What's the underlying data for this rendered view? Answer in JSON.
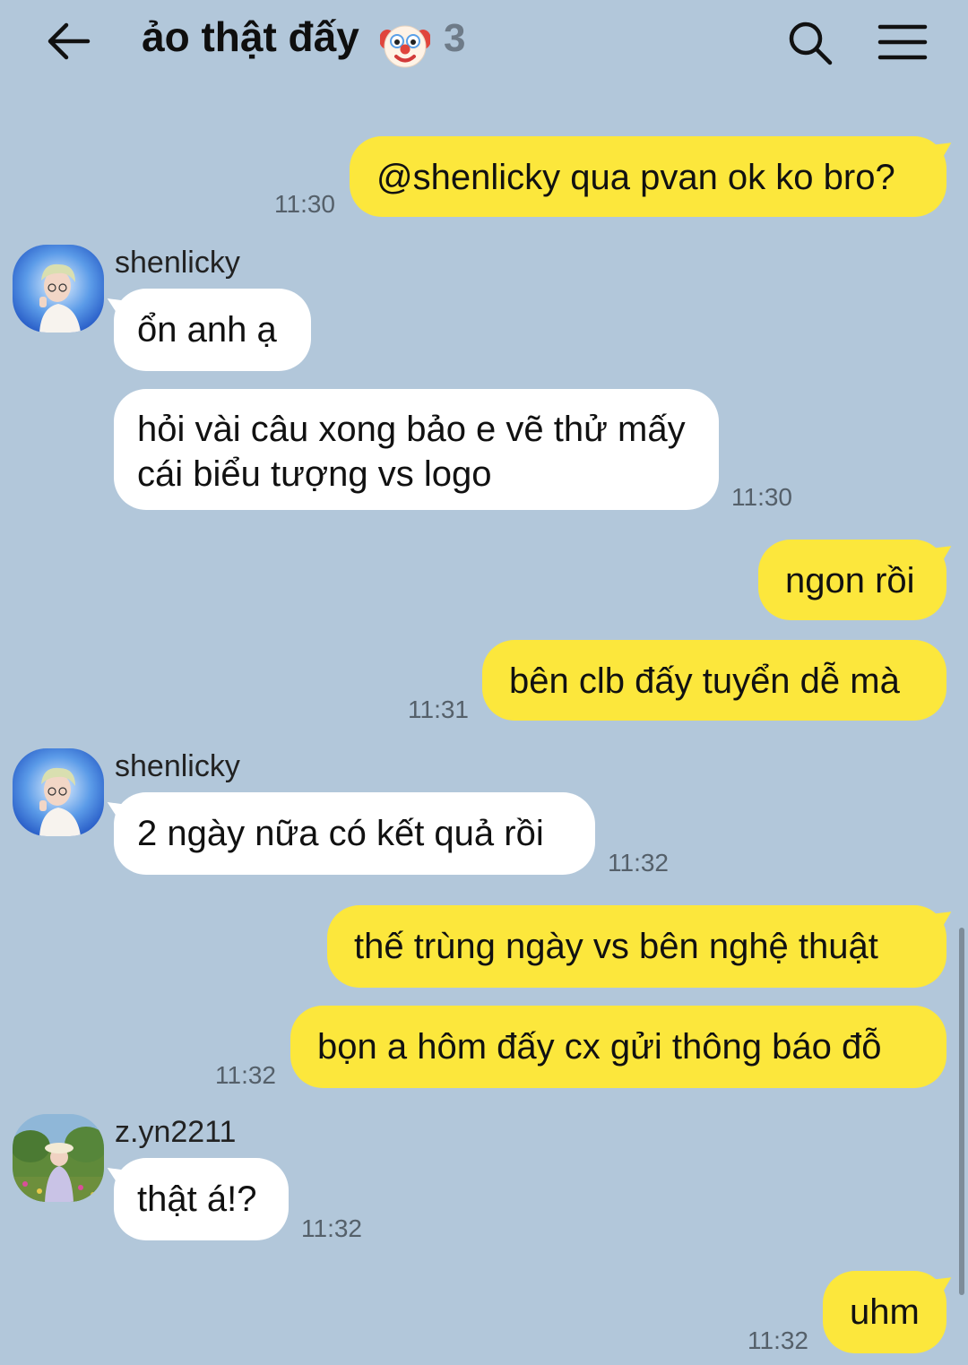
{
  "header": {
    "title": "ảo thật đấy",
    "member_count": "3"
  },
  "messages": [
    {
      "text": "@shenlicky qua pvan ok ko bro?",
      "time": "11:30"
    },
    {
      "sender": "shenlicky",
      "text": "ổn anh ạ"
    },
    {
      "text": "hỏi vài câu xong bảo e vẽ thử mấy cái biểu tượng vs logo",
      "time": "11:30"
    },
    {
      "text": "ngon rồi"
    },
    {
      "text": "bên clb đấy tuyển dễ mà",
      "time": "11:31"
    },
    {
      "sender": "shenlicky",
      "text": "2 ngày nữa có kết quả rồi",
      "time": "11:32"
    },
    {
      "text": "thế trùng ngày vs bên nghệ thuật"
    },
    {
      "text": "bọn a hôm đấy cx gửi thông báo đỗ",
      "time": "11:32"
    },
    {
      "sender": "z.yn2211",
      "text": "thật á!?",
      "time": "11:32"
    },
    {
      "text": "uhm",
      "time": "11:32"
    }
  ],
  "colors": {
    "background": "#b2c7da",
    "my_bubble": "#fce73c",
    "their_bubble": "#ffffff"
  },
  "icons": [
    "back-arrow-icon",
    "clown-emoji-icon",
    "search-icon",
    "menu-icon"
  ]
}
